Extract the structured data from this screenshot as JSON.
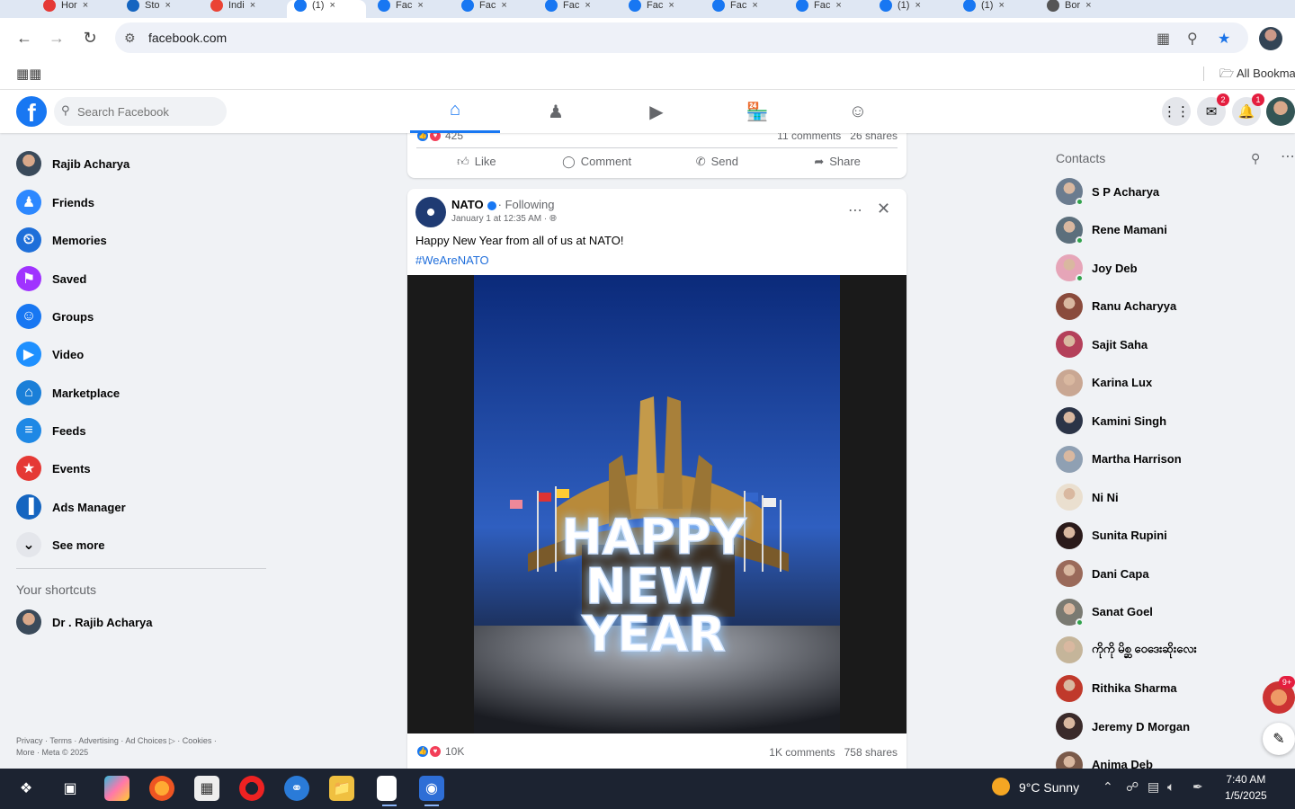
{
  "browser": {
    "tabs": [
      {
        "label": "Hor"
      },
      {
        "label": "Sto"
      },
      {
        "label": "Indi"
      },
      {
        "label": "(1)",
        "active": true
      },
      {
        "label": "Fac"
      },
      {
        "label": "Fac"
      },
      {
        "label": "Fac"
      },
      {
        "label": "Fac"
      },
      {
        "label": "Fac"
      },
      {
        "label": "Fac"
      },
      {
        "label": "(1)"
      },
      {
        "label": "(1)"
      },
      {
        "label": "Bor"
      }
    ],
    "url": "facebook.com",
    "bookmarks_label": "All Bookma"
  },
  "fb": {
    "logo": "f",
    "search_placeholder": "Search Facebook",
    "nav_tabs": [
      {
        "icon": "home-icon",
        "active": true
      },
      {
        "icon": "friends-icon"
      },
      {
        "icon": "video-icon"
      },
      {
        "icon": "marketplace-icon"
      },
      {
        "icon": "groups-icon"
      }
    ],
    "messenger_badge": "2",
    "notifications_badge": "1"
  },
  "sidebar": {
    "items": [
      {
        "label": "Rajib Acharya",
        "icon": "profile-avatar"
      },
      {
        "label": "Friends",
        "icon": "friends-icon"
      },
      {
        "label": "Memories",
        "icon": "clock-icon"
      },
      {
        "label": "Saved",
        "icon": "bookmark-icon"
      },
      {
        "label": "Groups",
        "icon": "groups-icon"
      },
      {
        "label": "Video",
        "icon": "video-icon"
      },
      {
        "label": "Marketplace",
        "icon": "marketplace-icon"
      },
      {
        "label": "Feeds",
        "icon": "feeds-icon"
      },
      {
        "label": "Events",
        "icon": "calendar-icon"
      },
      {
        "label": "Ads Manager",
        "icon": "bar-chart-icon"
      },
      {
        "label": "See more",
        "icon": "chevron-down-icon"
      }
    ],
    "shortcuts_title": "Your shortcuts",
    "shortcut": "Dr . Rajib Acharya",
    "footer_line1": "Privacy · Terms · Advertising · Ad Choices ▷ · Cookies ·",
    "footer_line2": "More · Meta © 2025"
  },
  "feed": {
    "prev_post": {
      "reactions": "425",
      "comments": "11 comments",
      "shares": "26 shares",
      "actions": {
        "like": "Like",
        "comment": "Comment",
        "send": "Send",
        "share": "Share"
      }
    },
    "post": {
      "author": "NATO",
      "following": "· Following",
      "time": "January 1 at 12:35 AM ·",
      "text": "Happy New Year from all of us at NATO!",
      "hashtag": "#WeAreNATO",
      "image_text": [
        "HAPPY",
        "NEW",
        "YEAR"
      ],
      "reactions": "10K",
      "comments": "1K comments",
      "shares": "758 shares"
    }
  },
  "contacts": {
    "title": "Contacts",
    "list": [
      {
        "name": "S P Acharya",
        "online": true,
        "color": "#6b7c8f"
      },
      {
        "name": "Rene Mamani",
        "online": true,
        "color": "#5c6f7c"
      },
      {
        "name": "Joy Deb",
        "online": true,
        "color": "#e6a5b8"
      },
      {
        "name": "Ranu Acharyya",
        "online": false,
        "color": "#8a4b3c"
      },
      {
        "name": "Sajit Saha",
        "online": false,
        "color": "#b4405a"
      },
      {
        "name": "Karina Lux",
        "online": false,
        "color": "#c9a793"
      },
      {
        "name": "Kamini Singh",
        "online": false,
        "color": "#2b3447"
      },
      {
        "name": "Martha Harrison",
        "online": false,
        "color": "#8fa0b3"
      },
      {
        "name": "Ni Ni",
        "online": false,
        "color": "#eadfcf"
      },
      {
        "name": "Sunita Rupini",
        "online": false,
        "color": "#2a1a1a"
      },
      {
        "name": "Dani Capa",
        "online": false,
        "color": "#9a6a5a"
      },
      {
        "name": "Sanat Goel",
        "online": true,
        "color": "#7a7a72"
      },
      {
        "name": "ကိုကို မိစ္ဆ ဝေဒေးဆိုးလေး",
        "online": false,
        "color": "#c5b59a"
      },
      {
        "name": "Rithika Sharma",
        "online": false,
        "color": "#c0392b"
      },
      {
        "name": "Jeremy D Morgan",
        "online": false,
        "color": "#3a2a2a"
      },
      {
        "name": "Anima Deb",
        "online": false,
        "color": "#7a5a4a"
      }
    ],
    "chat_badge": "9+"
  },
  "taskbar": {
    "weather": "9°C  Sunny",
    "time": "7:40 AM",
    "date": "1/5/2025"
  }
}
